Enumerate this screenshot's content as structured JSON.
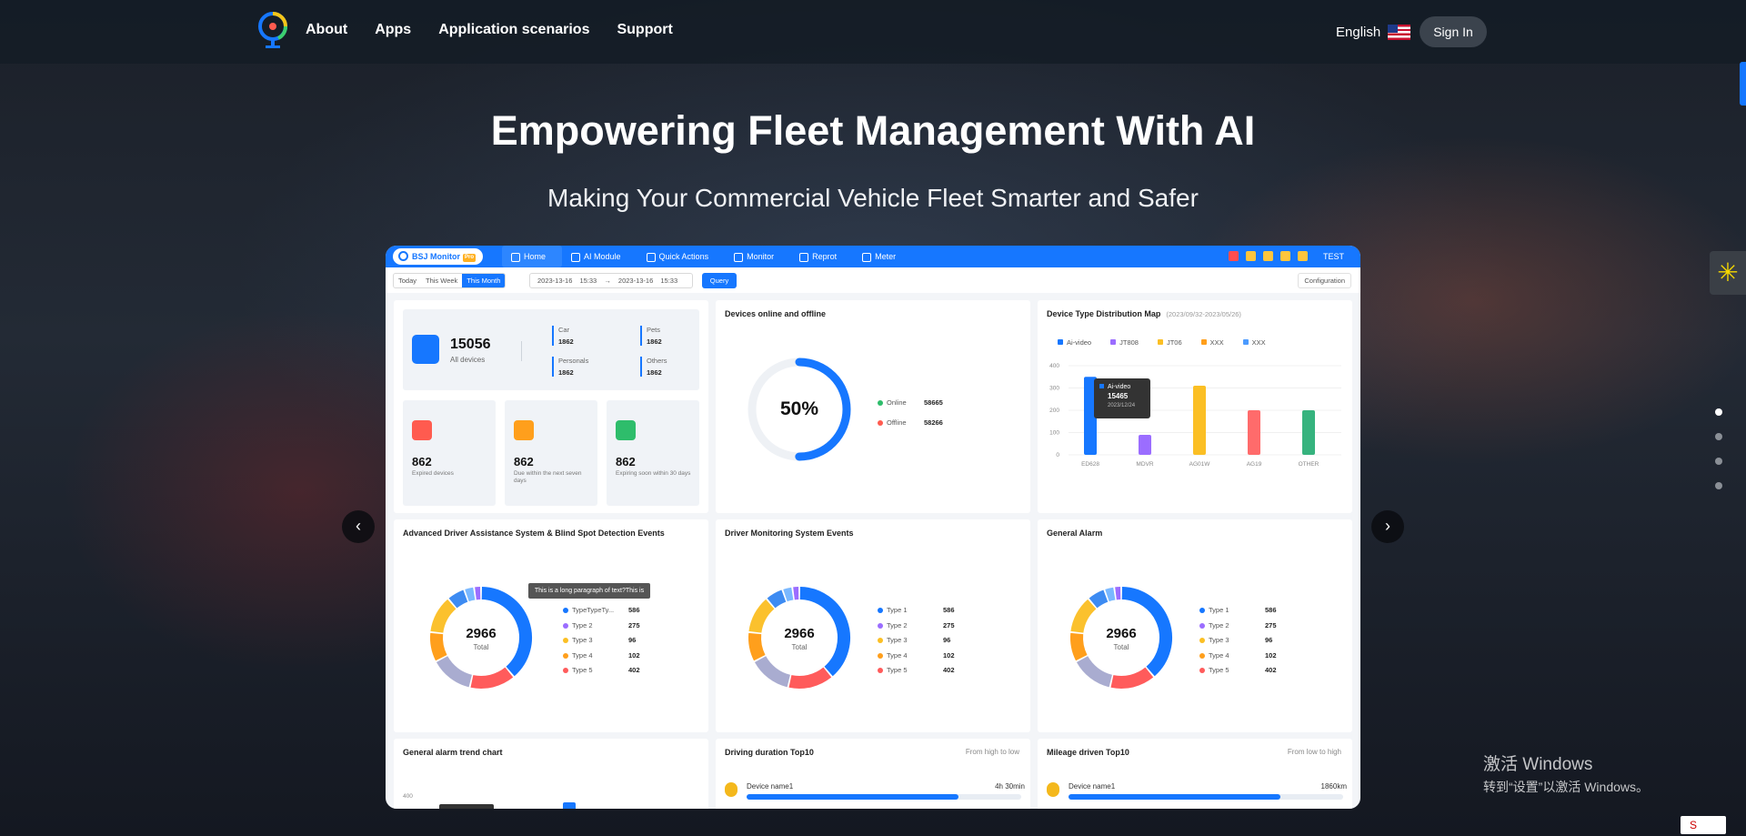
{
  "nav": {
    "items": [
      "About",
      "Apps",
      "Application scenarios",
      "Support"
    ]
  },
  "header": {
    "language": "English",
    "sign_in": "Sign In"
  },
  "hero": {
    "title": "Empowering Fleet Management With AI",
    "subtitle": "Making Your Commercial Vehicle Fleet Smarter and Safer"
  },
  "carousel": {
    "prev": "‹",
    "next": "›",
    "slides": 4,
    "active": 1
  },
  "dashboard": {
    "brand": "BSJ Monitor",
    "brand_badge": "Pro",
    "nav": [
      "Home",
      "AI Module",
      "Quick Actions",
      "Monitor",
      "Reprot",
      "Meter"
    ],
    "user": "TEST",
    "filter": {
      "periods": [
        "Today",
        "This Week",
        "This Month"
      ],
      "start": "2023-13-16 15:33",
      "arrow": "→",
      "end": "2023-13-16 15:33",
      "query": "Query",
      "config": "Configuration"
    },
    "summary": {
      "total": "15056",
      "total_label": "All devices",
      "car_label": "Car",
      "car": "1862",
      "pets_label": "Pets",
      "pets": "1862",
      "personals_label": "Personals",
      "personals": "1862",
      "others_label": "Others",
      "others": "1862"
    },
    "minis": [
      {
        "value": "862",
        "label": "Expired devices",
        "color": "#ff5b4f"
      },
      {
        "value": "862",
        "label": "Due within the next seven days",
        "color": "#ff9f1c"
      },
      {
        "value": "862",
        "label": "Expiring soon within 30 days",
        "color": "#2ebd6b"
      }
    ],
    "online": {
      "title": "Devices online and offline",
      "percent": "50%",
      "online_label": "Online",
      "online": "58665",
      "offline_label": "Offline",
      "offline": "58266",
      "fraction": 0.5
    },
    "distribution": {
      "title": "Device Type Distribution Map",
      "period": "(2023/09/32-2023/05/26)",
      "legend": [
        "Ai-video",
        "JT808",
        "JT06",
        "XXX",
        "XXX"
      ],
      "tooltip": {
        "name": "Ai-video",
        "value": "15465",
        "date": "2023/12/24"
      }
    },
    "adas": {
      "title": "Advanced Driver Assistance System & Blind Spot Detection Events",
      "tooltip": "This is a long paragraph of text?This is",
      "total": "2966",
      "total_label": "Total",
      "legend": [
        {
          "name": "TypeTypeTy...",
          "value": "586"
        },
        {
          "name": "Type 2",
          "value": "275"
        },
        {
          "name": "Type 3",
          "value": "96"
        },
        {
          "name": "Type 4",
          "value": "102"
        },
        {
          "name": "Type 5",
          "value": "402"
        }
      ]
    },
    "dms": {
      "title": "Driver Monitoring System Events",
      "total": "2966",
      "total_label": "Total",
      "legend": [
        {
          "name": "Type 1",
          "value": "586"
        },
        {
          "name": "Type 2",
          "value": "275"
        },
        {
          "name": "Type 3",
          "value": "96"
        },
        {
          "name": "Type 4",
          "value": "102"
        },
        {
          "name": "Type 5",
          "value": "402"
        }
      ]
    },
    "general": {
      "title": "General Alarm",
      "total": "2966",
      "total_label": "Total",
      "legend": [
        {
          "name": "Type 1",
          "value": "586"
        },
        {
          "name": "Type 2",
          "value": "275"
        },
        {
          "name": "Type 3",
          "value": "96"
        },
        {
          "name": "Type 4",
          "value": "102"
        },
        {
          "name": "Type 5",
          "value": "402"
        }
      ]
    },
    "trend": {
      "title": "General alarm trend chart",
      "y_top": "400"
    },
    "driving": {
      "title": "Driving duration Top10",
      "sort": "From high to low",
      "name": "Device name1",
      "value": "4h 30min",
      "fraction": 0.77
    },
    "mileage": {
      "title": "Mileage driven Top10",
      "sort": "From low to high",
      "name": "Device name1",
      "value": "1860km",
      "fraction": 0.77
    }
  },
  "chart_data": [
    {
      "type": "bar",
      "title": "Device Type Distribution Map",
      "categories": [
        "ED628",
        "MDVR",
        "AG01W",
        "AG19",
        "OTHER"
      ],
      "values": [
        350,
        90,
        310,
        200,
        200
      ],
      "colors": [
        "#1677ff",
        "#9b6dff",
        "#fbbf24",
        "#ff6b6b",
        "#36b37e"
      ],
      "ylim": [
        0,
        400
      ],
      "yticks": [
        "0",
        "100",
        "200",
        "300",
        "400"
      ]
    },
    {
      "type": "pie",
      "title": "Advanced Driver Assistance System & Blind Spot Detection Events",
      "categories": [
        "TypeTypeTy...",
        "Type 2",
        "Type 3",
        "Type 4",
        "Type 5"
      ],
      "values": [
        586,
        275,
        96,
        102,
        402
      ]
    },
    {
      "type": "pie",
      "title": "Driver Monitoring System Events",
      "categories": [
        "Type 1",
        "Type 2",
        "Type 3",
        "Type 4",
        "Type 5"
      ],
      "values": [
        586,
        275,
        96,
        102,
        402
      ]
    },
    {
      "type": "pie",
      "title": "General Alarm",
      "categories": [
        "Type 1",
        "Type 2",
        "Type 3",
        "Type 4",
        "Type 5"
      ],
      "values": [
        586,
        275,
        96,
        102,
        402
      ]
    }
  ],
  "colors": {
    "accent": "#1677ff",
    "donut": [
      "#1677ff",
      "#ff5b5b",
      "#a9acd0",
      "#ff9f1c",
      "#fbc12d",
      "#3d8bf2",
      "#79b8ff",
      "#9b6dff"
    ]
  },
  "windows": {
    "line1": "激活 Windows",
    "line2": "转到“设置”以激活 Windows。"
  },
  "tray": "S"
}
